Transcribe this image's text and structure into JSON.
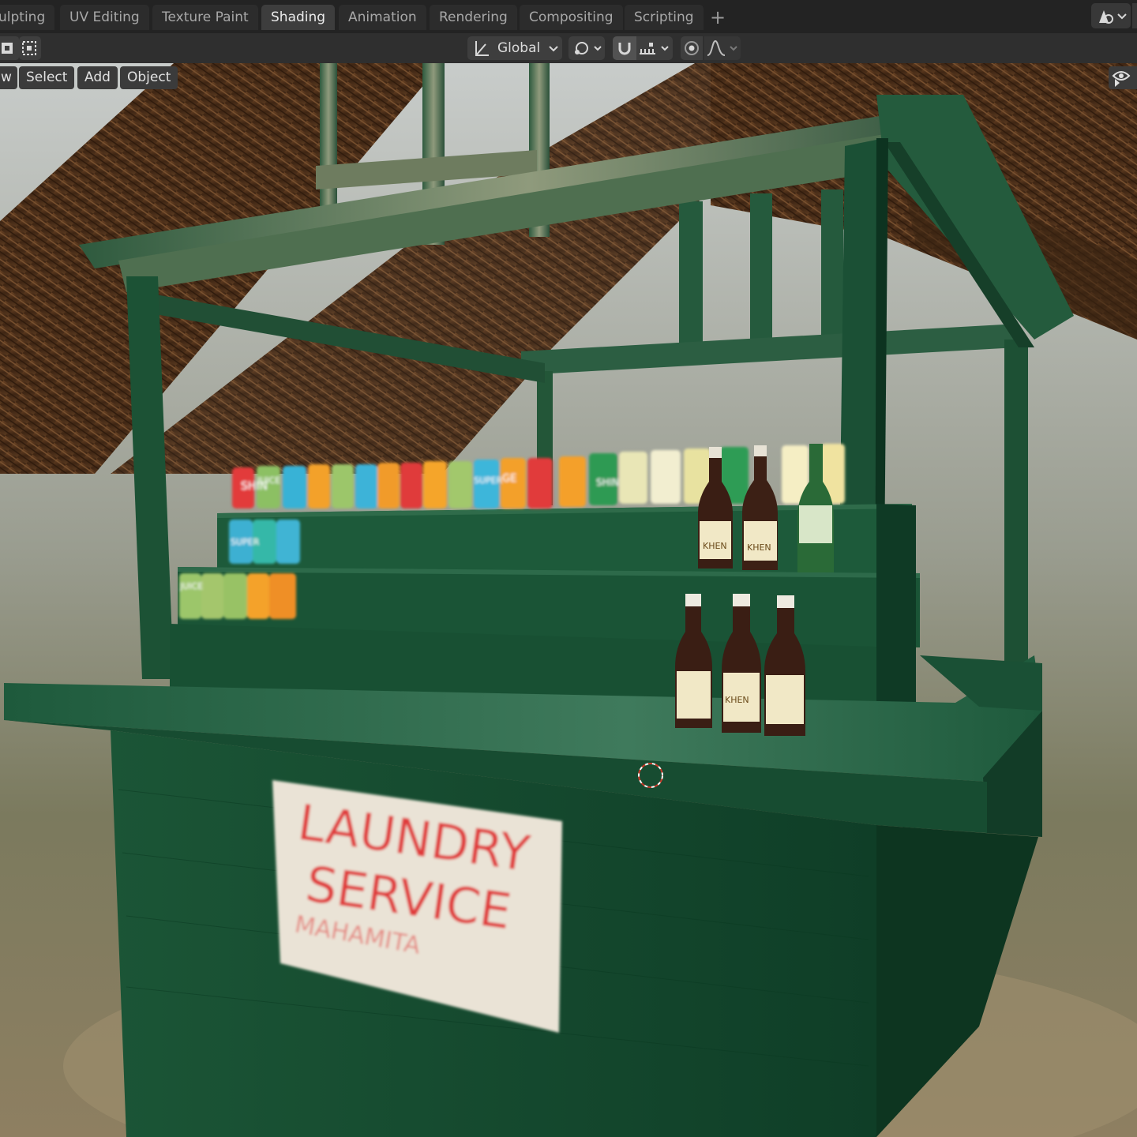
{
  "workspace_tabs": [
    {
      "label": "ulpting",
      "active": false
    },
    {
      "label": "UV Editing",
      "active": false
    },
    {
      "label": "Texture Paint",
      "active": false
    },
    {
      "label": "Shading",
      "active": true
    },
    {
      "label": "Animation",
      "active": false
    },
    {
      "label": "Rendering",
      "active": false
    },
    {
      "label": "Compositing",
      "active": false
    },
    {
      "label": "Scripting",
      "active": false
    }
  ],
  "add_workspace_icon": "plus-icon",
  "toolbar": {
    "transform_orientation": "Global",
    "pivot_icon": "pivot-point-icon",
    "snap_icon": "magnet-icon",
    "snap_target_icon": "snap-increment-icon",
    "proportional_icon": "proportional-edit-icon",
    "falloff_icon": "falloff-curve-icon"
  },
  "viewport_header": {
    "menus": [
      "w",
      "Select",
      "Add",
      "Object"
    ],
    "overlay_icon": "eye-icon"
  },
  "scene": {
    "sign_lines": [
      "LAUNDRY",
      "SERVICE",
      "MAHAMITA"
    ],
    "can_labels": [
      "SHIN",
      "JUICE",
      "SUPER",
      "GE"
    ],
    "bottle_label": "KHEN",
    "cursor_icon": "3d-cursor-icon"
  },
  "colors": {
    "stall_green": "#1f5a3a",
    "active_tab": "#3d3d3d",
    "sign_red": "#e03b3b"
  }
}
